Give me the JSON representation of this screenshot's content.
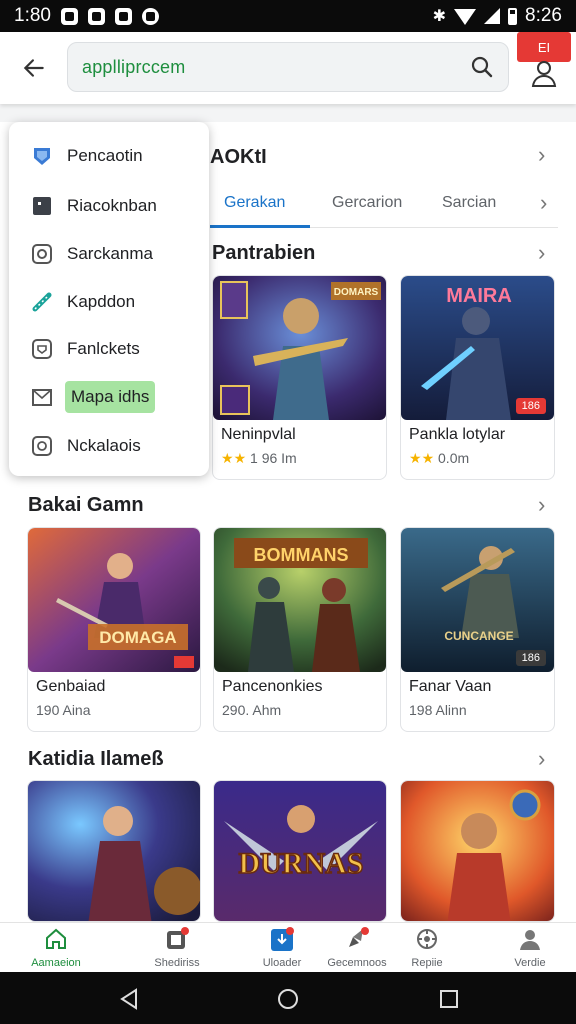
{
  "status_bar": {
    "time_left": "1:80",
    "time_right": "8:26"
  },
  "search": {
    "query": "applliprccem"
  },
  "header_badge": "EI",
  "side_menu": {
    "items": [
      {
        "label": "Pencaotin",
        "icon": "shield-cube-icon"
      },
      {
        "label": "Riacoknban",
        "icon": "app-tile-icon"
      },
      {
        "label": "Sarckanma",
        "icon": "target-icon"
      },
      {
        "label": "Kapddon",
        "icon": "link-icon"
      },
      {
        "label": "Fanlckets",
        "icon": "shield-icon"
      },
      {
        "label": "Mapa idhs",
        "icon": "envelope-icon",
        "highlighted": true
      },
      {
        "label": "Nckalaois",
        "icon": "camera-icon"
      }
    ]
  },
  "section1": {
    "title": "AOKtI"
  },
  "tabs": [
    {
      "label": "Gerakan",
      "active": true
    },
    {
      "label": "Gercarion",
      "active": false
    },
    {
      "label": "Sarcian",
      "active": false
    }
  ],
  "section2": {
    "title": "Pantrabien",
    "cards": [
      {
        "title": "Neninpvlal",
        "meta": "1 96 Im",
        "tag": "",
        "rating_stars": 2,
        "thumb_caption": "DOMARS"
      },
      {
        "title": "Pankla lotylar",
        "meta": "0.0m",
        "tag": "186",
        "rating_stars": 2,
        "thumb_caption": "MAIRA"
      }
    ]
  },
  "section3": {
    "title": "Bakai Gamn",
    "cards": [
      {
        "title": "Genbaiad",
        "meta": "190 Aina",
        "tag": "",
        "thumb_caption": "DOMAGA"
      },
      {
        "title": "Pancenonkies",
        "meta": "290. Ahm",
        "tag": "",
        "thumb_caption": "BOMMANS"
      },
      {
        "title": "Fanar Vaan",
        "meta": "198 Alinn",
        "tag": "186",
        "thumb_caption": "CUNCANGE"
      }
    ]
  },
  "section4": {
    "title": "Katidia Ilameß",
    "cards": [
      {
        "thumb_caption": ""
      },
      {
        "thumb_caption": "DURNAS"
      },
      {
        "thumb_caption": ""
      }
    ]
  },
  "bottom_nav": [
    {
      "label": "Aamaeion",
      "icon": "home-icon",
      "active": true
    },
    {
      "label": "Shediriss",
      "icon": "apps-icon",
      "active": false
    },
    {
      "label": "Uloader",
      "icon": "download-icon",
      "active": false
    },
    {
      "label": "Gecemnoos",
      "icon": "rocket-icon",
      "active": false
    },
    {
      "label": "Repiie",
      "icon": "settings-icon",
      "active": false
    },
    {
      "label": "Verdie",
      "icon": "person-icon",
      "active": false
    }
  ],
  "colors": {
    "accent_blue": "#1a73c8",
    "accent_green": "#1e8e3e",
    "badge_red": "#e53935",
    "highlight_green": "#a6e3a1"
  }
}
